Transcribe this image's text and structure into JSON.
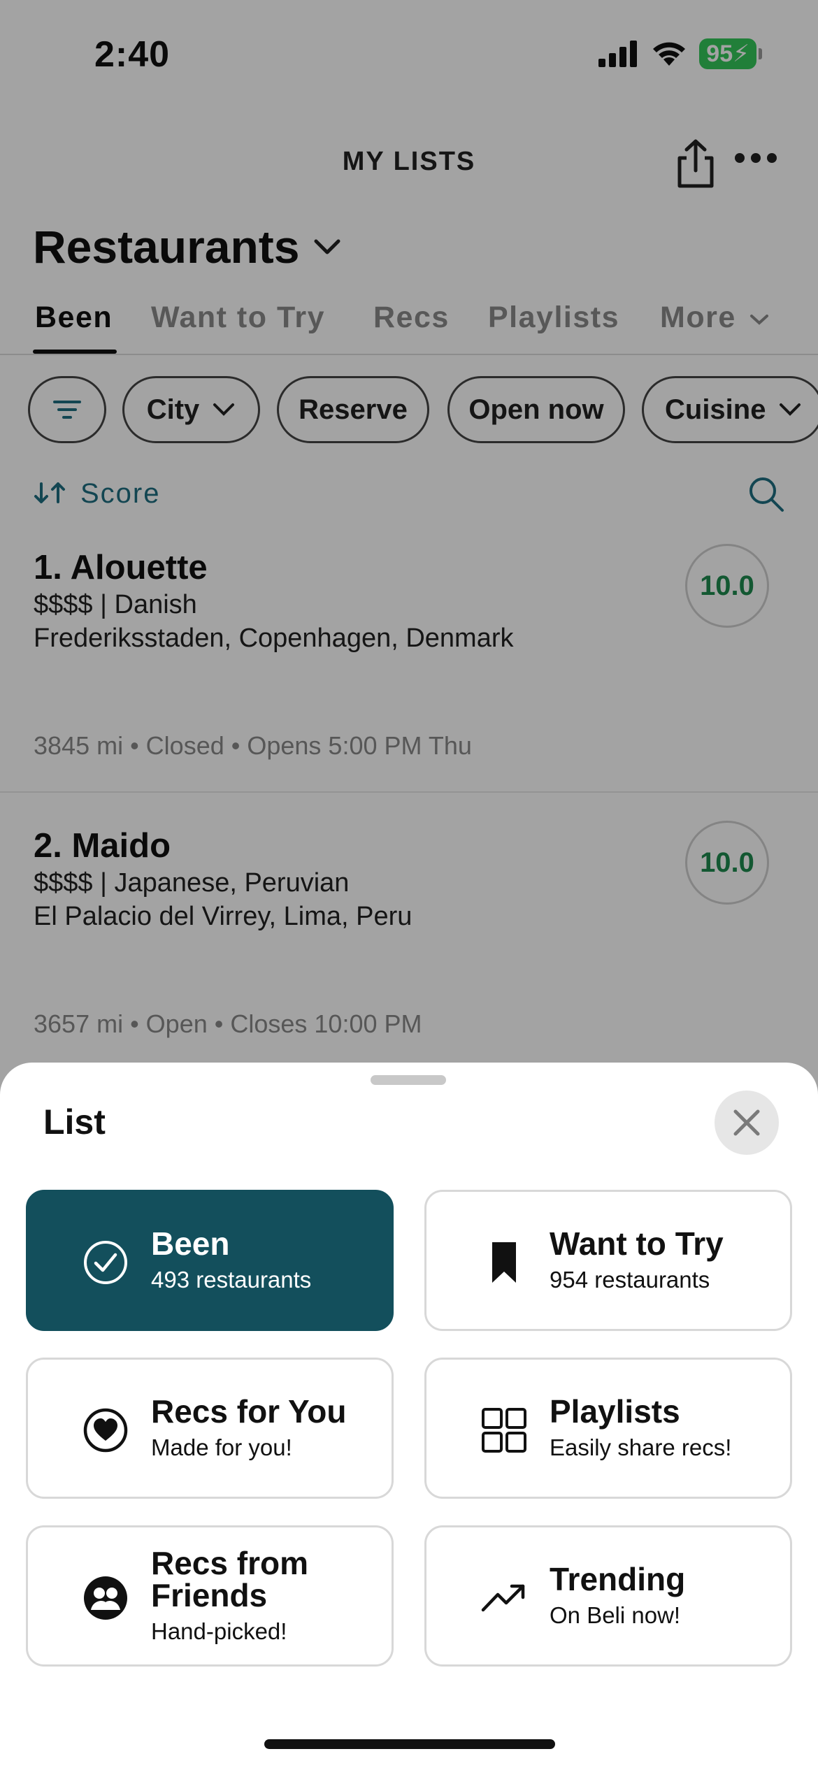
{
  "status_bar": {
    "time": "2:40",
    "battery": "95"
  },
  "header": {
    "title": "MY LISTS"
  },
  "list": {
    "title": "Restaurants"
  },
  "tabs": [
    {
      "label": "Been",
      "active": true
    },
    {
      "label": "Want to Try"
    },
    {
      "label": "Recs"
    },
    {
      "label": "Playlists"
    },
    {
      "label": "More"
    }
  ],
  "filters": {
    "city": "City",
    "reserve": "Reserve",
    "open_now": "Open now",
    "cuisine": "Cuisine"
  },
  "sort": {
    "label": "Score"
  },
  "restaurants": [
    {
      "name": "1. Alouette",
      "meta": "$$$$ | Danish",
      "location": "Frederiksstaden, Copenhagen, Denmark",
      "info": "3845 mi • Closed • Opens 5:00 PM Thu",
      "score": "10.0"
    },
    {
      "name": "2. Maido",
      "meta": "$$$$ | Japanese, Peruvian",
      "location": "El Palacio del Virrey, Lima, Peru",
      "info": "3657 mi • Open • Closes 10:00 PM",
      "score": "10.0"
    }
  ],
  "sheet": {
    "title": "List",
    "cards": [
      {
        "title": "Been",
        "subtitle": "493 restaurants",
        "icon": "check-circle-icon",
        "selected": true
      },
      {
        "title": "Want to Try",
        "subtitle": "954 restaurants",
        "icon": "bookmark-icon"
      },
      {
        "title": "Recs for You",
        "subtitle": "Made for you!",
        "icon": "heart-circle-icon"
      },
      {
        "title": "Playlists",
        "subtitle": "Easily share recs!",
        "icon": "grid-icon"
      },
      {
        "title": "Recs from Friends",
        "subtitle": "Hand-picked!",
        "icon": "friends-icon"
      },
      {
        "title": "Trending",
        "subtitle": "On Beli now!",
        "icon": "trending-icon"
      }
    ]
  },
  "colors": {
    "accent": "#134f5c",
    "score_green": "#1e8a4f",
    "sort_teal": "#1f6e80"
  }
}
